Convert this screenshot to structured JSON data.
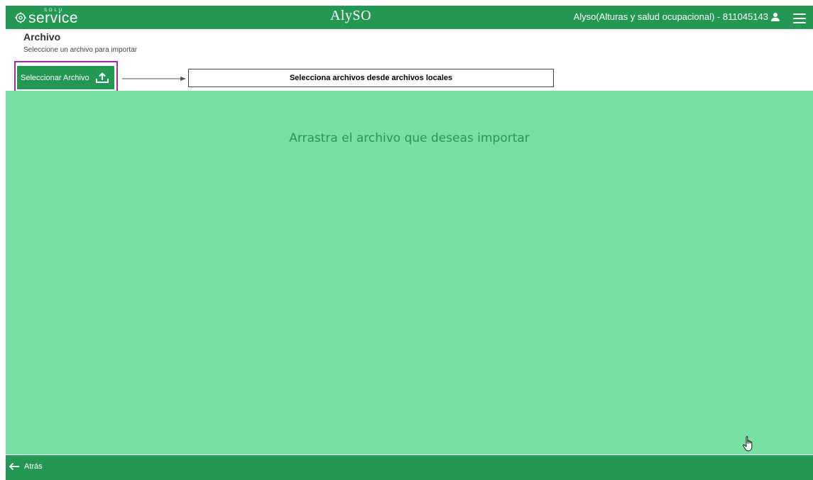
{
  "header": {
    "brand_small": "SOLU",
    "brand_name": "service",
    "center_logo": "AlySO",
    "account_label": "Alyso(Alturas y salud ocupacional) - 811045143",
    "user_icon": "user-icon",
    "menu_icon": "hamburger-menu-icon"
  },
  "page": {
    "title": "Archivo",
    "subtitle": "Seleccione un archivo para importar"
  },
  "actions": {
    "select_file_label": "Seleccionar Archivo",
    "upload_icon": "upload-icon"
  },
  "annotation": {
    "callout_text": "Selecciona archivos desde archivos locales",
    "highlight_color": "#9b2ea8"
  },
  "dropzone": {
    "prompt": "Arrastra el archivo que deseas importar"
  },
  "footer": {
    "back_label": "Atrás",
    "back_icon": "arrow-left-icon"
  },
  "colors": {
    "primary_green": "#239753",
    "dropzone_green": "#77e0a4",
    "dropzone_text": "#2c9456"
  }
}
